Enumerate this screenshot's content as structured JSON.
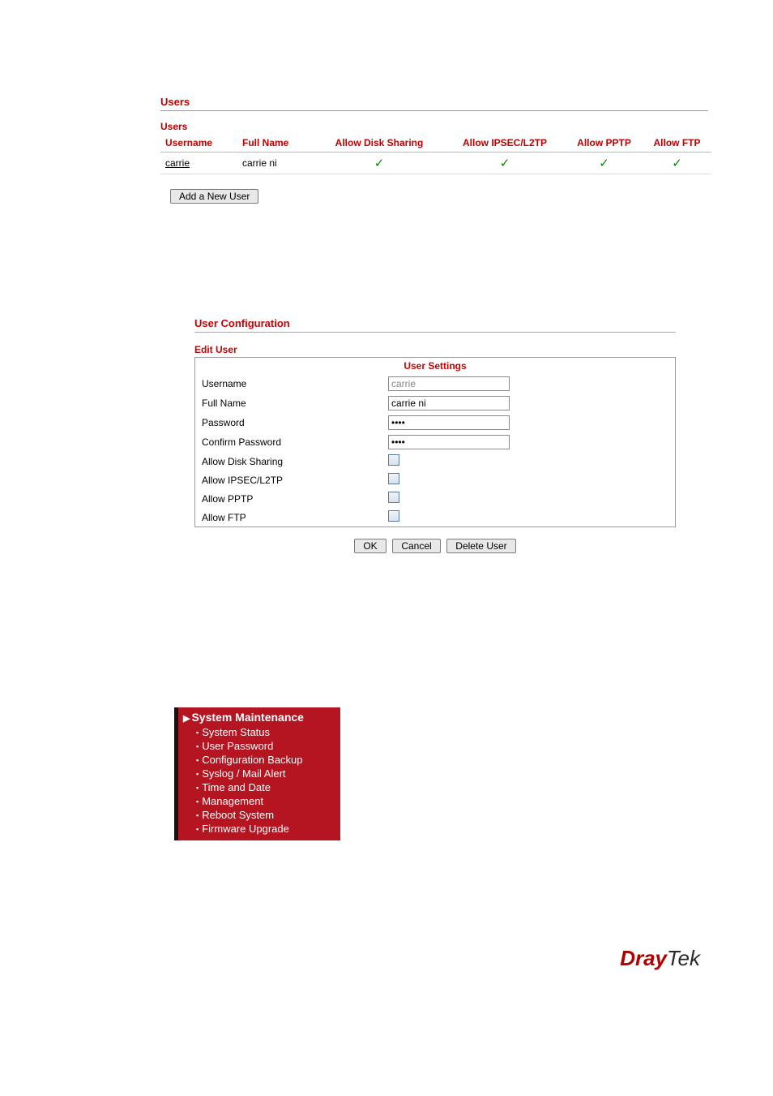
{
  "usersPanel": {
    "title": "Users",
    "tableLabel": "Users",
    "headers": {
      "username": "Username",
      "fullname": "Full Name",
      "disk": "Allow Disk Sharing",
      "ipsec": "Allow IPSEC/L2TP",
      "pptp": "Allow PPTP",
      "ftp": "Allow FTP"
    },
    "rows": [
      {
        "username": "carrie",
        "fullname": "carrie ni",
        "disk": "✓",
        "ipsec": "✓",
        "pptp": "✓",
        "ftp": "✓"
      }
    ],
    "addButton": "Add a New User"
  },
  "userConfig": {
    "title": "User Configuration",
    "editLabel": "Edit User",
    "caption": "User Settings",
    "fields": {
      "usernameLabel": "Username",
      "usernameValue": "carrie",
      "fullnameLabel": "Full Name",
      "fullnameValue": "carrie ni",
      "passwordLabel": "Password",
      "passwordValue": "••••",
      "confirmLabel": "Confirm Password",
      "confirmValue": "••••",
      "diskLabel": "Allow Disk Sharing",
      "ipsecLabel": "Allow IPSEC/L2TP",
      "pptpLabel": "Allow PPTP",
      "ftpLabel": "Allow FTP"
    },
    "buttons": {
      "ok": "OK",
      "cancel": "Cancel",
      "delete": "Delete User"
    }
  },
  "sidebar": {
    "header": "System Maintenance",
    "items": [
      "System Status",
      "User Password",
      "Configuration Backup",
      "Syslog / Mail Alert",
      "Time and Date",
      "Management",
      "Reboot System",
      "Firmware Upgrade"
    ]
  },
  "logo": {
    "part1": "Dray",
    "part2": "Tek"
  }
}
